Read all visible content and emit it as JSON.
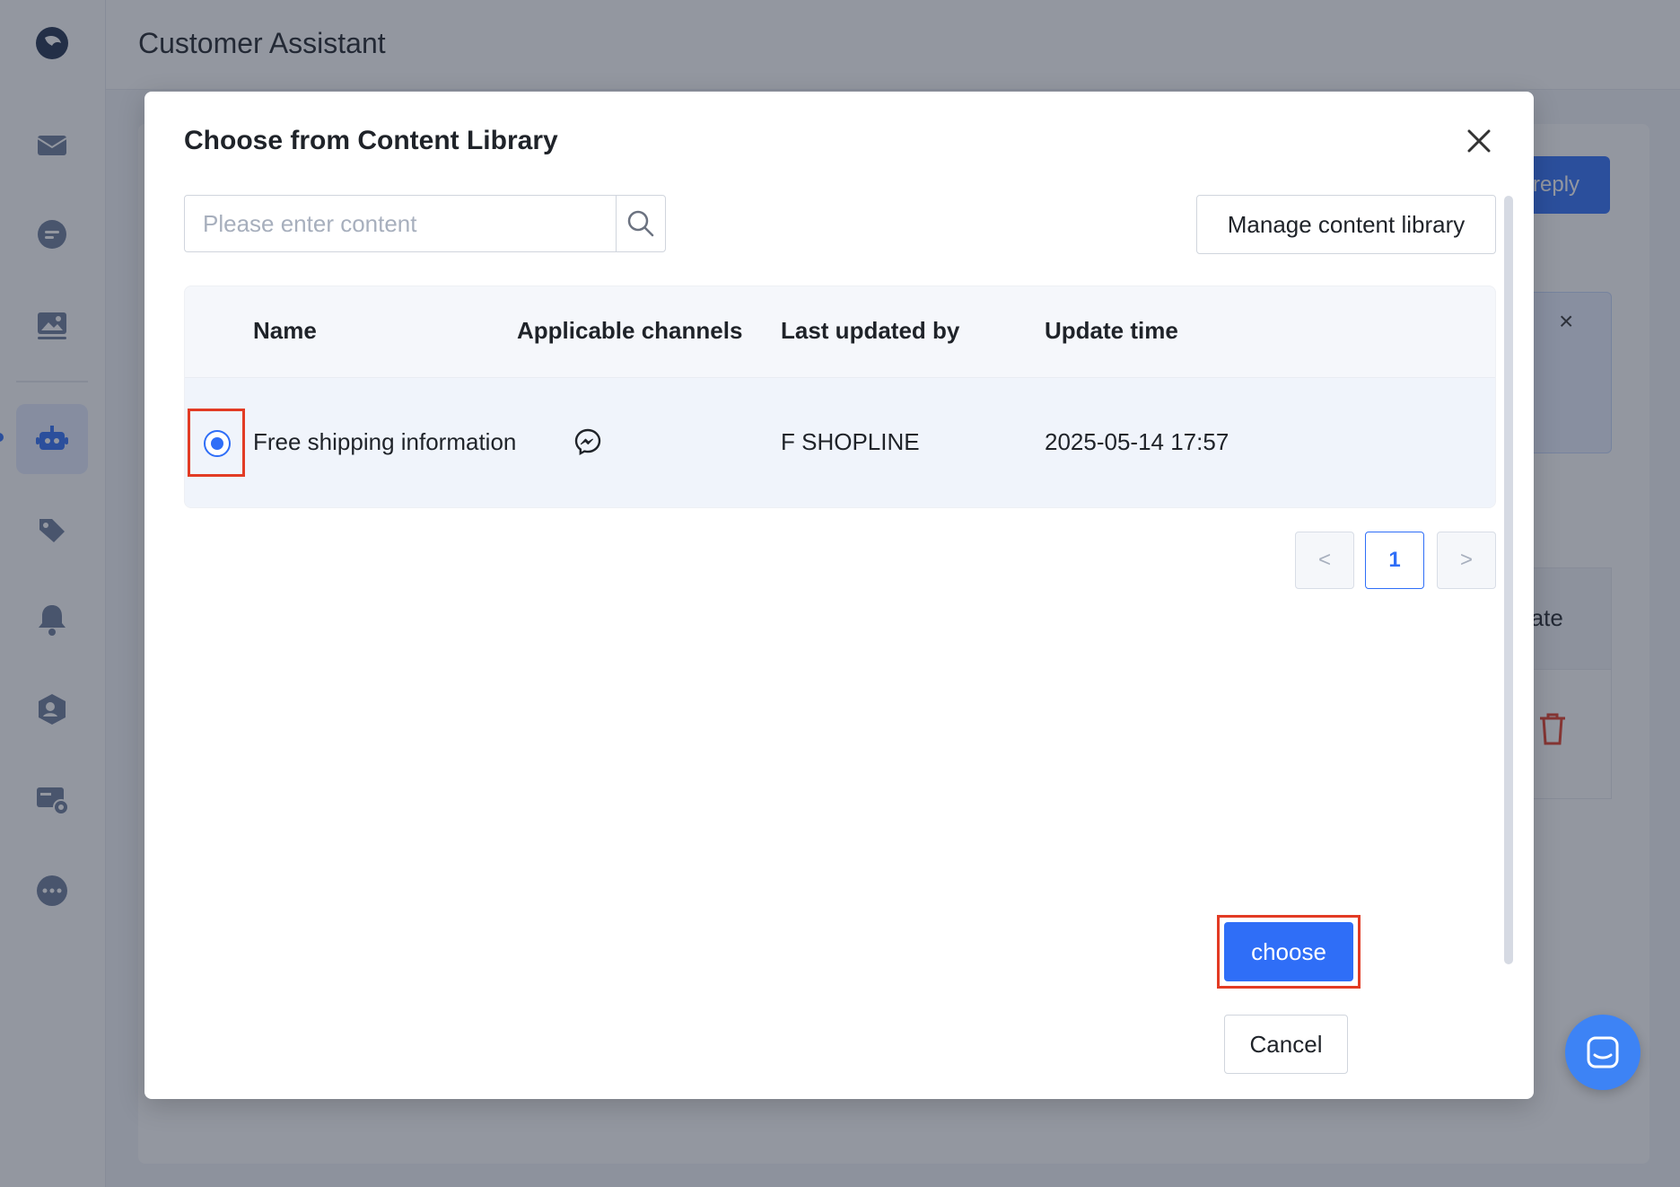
{
  "app": {
    "title": "Customer Assistant",
    "sidebar_icons": [
      "logo-icon",
      "mail-icon",
      "chat-icon",
      "image-icon",
      "robot-icon",
      "tags-icon",
      "bell-icon",
      "contacts-icon",
      "card-settings-icon",
      "more-icon"
    ],
    "background": {
      "reply_button_label": "reply",
      "notice_close": "×",
      "table_header_fragment": "rate"
    }
  },
  "modal": {
    "title": "Choose from Content Library",
    "search": {
      "placeholder": "Please enter content",
      "value": ""
    },
    "manage_button_label": "Manage content library",
    "table": {
      "columns": [
        "Name",
        "Applicable channels",
        "Last updated by",
        "Update time"
      ],
      "rows": [
        {
          "selected": true,
          "name": "Free shipping information",
          "channel_icon": "messenger-icon",
          "updated_by": "F SHOPLINE",
          "update_time": "2025-05-14 17:57"
        }
      ]
    },
    "pagination": {
      "prev": "<",
      "current_page": "1",
      "next": ">"
    },
    "cancel_label": "Cancel",
    "choose_label": "choose"
  },
  "colors": {
    "primary": "#2f6ef7",
    "highlight_border": "#e23b24",
    "overlay": "rgba(40,48,66,0.5)"
  }
}
